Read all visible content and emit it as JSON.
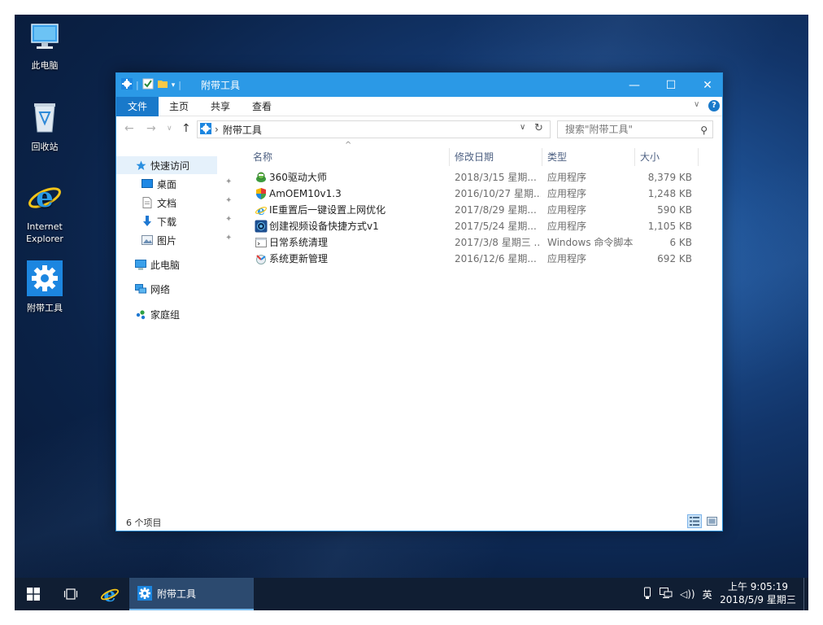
{
  "desktop": {
    "icons": [
      {
        "label": "此电脑"
      },
      {
        "label": "回收站"
      },
      {
        "label": "Internet Explorer"
      },
      {
        "label": "附带工具"
      }
    ]
  },
  "window": {
    "title": "附带工具",
    "controls": {
      "minimize": "—",
      "maximize": "☐",
      "close": "✕"
    },
    "ribbon": {
      "tabs": [
        "文件",
        "主页",
        "共享",
        "查看"
      ],
      "expand_glyph": "∨",
      "help_glyph": "?"
    },
    "address": {
      "back": "←",
      "forward": "→",
      "recent": "∨",
      "up": "↑",
      "separator": "›",
      "path": "附带工具",
      "dropdown": "∨",
      "refresh": "↻"
    },
    "search": {
      "placeholder": "搜索\"附带工具\"",
      "icon": "⚲"
    },
    "nav_pane": {
      "quick_access": "快速访问",
      "desktop": "桌面",
      "documents": "文档",
      "downloads": "下载",
      "pictures": "图片",
      "this_pc": "此电脑",
      "network": "网络",
      "homegroup": "家庭组",
      "pin_glyph": "✦"
    },
    "columns": {
      "name": "名称",
      "date": "修改日期",
      "type": "类型",
      "size": "大小",
      "sort_glyph": "^"
    },
    "files": [
      {
        "name": "360驱动大师",
        "date": "2018/3/15 星期...",
        "type": "应用程序",
        "size": "8,379 KB"
      },
      {
        "name": "AmOEM10v1.3",
        "date": "2016/10/27 星期...",
        "type": "应用程序",
        "size": "1,248 KB"
      },
      {
        "name": "IE重置后一键设置上网优化",
        "date": "2017/8/29 星期...",
        "type": "应用程序",
        "size": "590 KB"
      },
      {
        "name": "创建视频设备快捷方式v1",
        "date": "2017/5/24 星期...",
        "type": "应用程序",
        "size": "1,105 KB"
      },
      {
        "name": "日常系统清理",
        "date": "2017/3/8 星期三 ...",
        "type": "Windows 命令脚本",
        "size": "6 KB"
      },
      {
        "name": "系统更新管理",
        "date": "2016/12/6 星期...",
        "type": "应用程序",
        "size": "692 KB"
      }
    ],
    "status": {
      "item_count": "6 个项目"
    }
  },
  "taskbar": {
    "active_app": "附带工具",
    "tray": {
      "ime": "英",
      "volume": "◁))"
    },
    "clock": {
      "time": "上午 9:05:19",
      "date": "2018/5/9 星期三"
    }
  },
  "colors": {
    "titlebar": "#2b99e6",
    "file_tab": "#1979ca",
    "taskbar": "#101e33",
    "selection": "#e5f1fb"
  }
}
